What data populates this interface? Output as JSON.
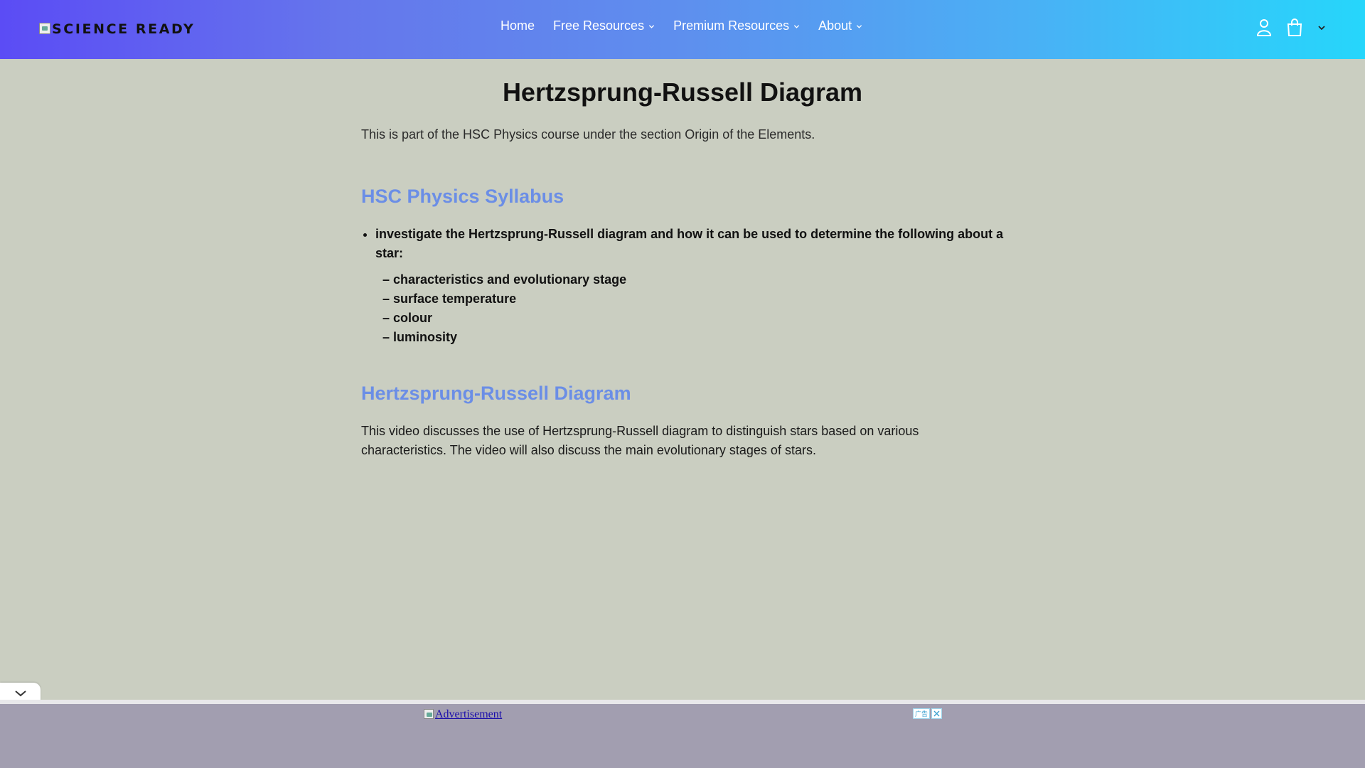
{
  "header": {
    "logo_text": "SCIENCE READY",
    "nav": [
      {
        "label": "Home",
        "has_dropdown": false
      },
      {
        "label": "Free Resources",
        "has_dropdown": true
      },
      {
        "label": "Premium Resources",
        "has_dropdown": true
      },
      {
        "label": "About",
        "has_dropdown": true
      }
    ],
    "icons": [
      "account-icon",
      "cart-icon",
      "chevron-down-icon"
    ],
    "gradient_colors": [
      "#5b4cf5",
      "#26d6fb"
    ]
  },
  "main": {
    "title": "Hertzsprung-Russell Diagram",
    "intro": "This is part of the HSC Physics course under the section Origin of the Elements.",
    "syllabus_heading": "HSC Physics Syllabus",
    "syllabus_item": "investigate the Hertzsprung-Russell diagram and how it can be used to determine the following about a star:",
    "syllabus_sub_items": [
      "– characteristics and evolutionary stage",
      "– surface temperature",
      "– colour",
      "– luminosity"
    ],
    "hr_heading": "Hertzsprung-Russell Diagram",
    "video_text": "This video discusses the use of Hertzsprung-Russell diagram to distinguish stars based on various characteristics. The video will also discuss the main evolutionary stages of stars."
  },
  "ad": {
    "link_text": "Advertisement",
    "badge_text": "广告"
  },
  "colors": {
    "background": "#cacec1",
    "heading_accent": "#6b8ee6",
    "ad_bar": "#a29eb0"
  }
}
